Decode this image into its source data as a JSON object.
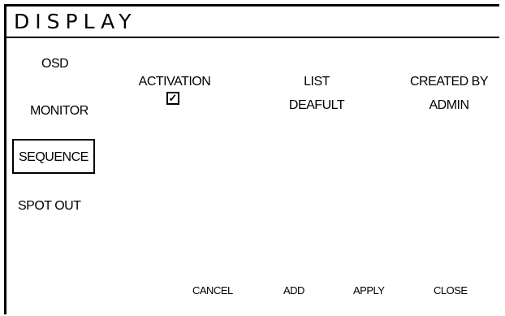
{
  "window": {
    "title": "DISPLAY"
  },
  "menu": {
    "items": [
      {
        "label": "OSD"
      },
      {
        "label": "MONITOR"
      },
      {
        "label": "SEQUENCE"
      },
      {
        "label": "SPOT OUT"
      }
    ],
    "selected": "SEQUENCE"
  },
  "table": {
    "headers": [
      "ACTIVATION",
      "LIST",
      "CREATED BY"
    ],
    "rows": [
      {
        "activation_checked": true,
        "list": "DEAFULT",
        "created_by": "ADMIN"
      }
    ]
  },
  "buttons": {
    "cancel": "CANCEL",
    "add": "ADD",
    "apply": "APPLY",
    "close": "CLOSE"
  }
}
